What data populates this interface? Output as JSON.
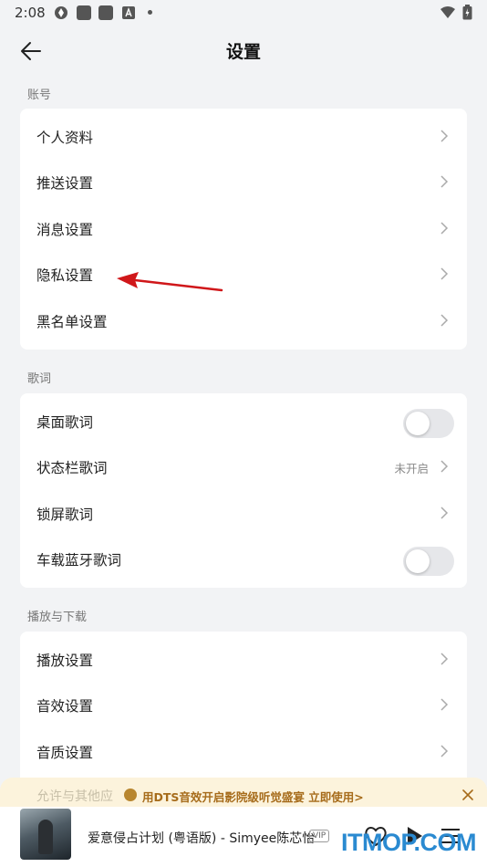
{
  "status_bar": {
    "time": "2:08"
  },
  "header": {
    "title": "设置"
  },
  "sections": [
    {
      "label": "账号",
      "items": [
        {
          "label": "个人资料"
        },
        {
          "label": "推送设置"
        },
        {
          "label": "消息设置"
        },
        {
          "label": "隐私设置"
        },
        {
          "label": "黑名单设置"
        }
      ]
    },
    {
      "label": "歌词",
      "items": [
        {
          "label": "桌面歌词",
          "toggle": false
        },
        {
          "label": "状态栏歌词",
          "value": "未开启"
        },
        {
          "label": "锁屏歌词"
        },
        {
          "label": "车载蓝牙歌词",
          "toggle": false
        }
      ]
    },
    {
      "label": "播放与下载",
      "items": [
        {
          "label": "播放设置"
        },
        {
          "label": "音效设置"
        },
        {
          "label": "音质设置"
        },
        {
          "label": "允许与其他应"
        }
      ]
    }
  ],
  "promo": {
    "text": "用DTS音效开启影院级听觉盛宴 立即使用>"
  },
  "player": {
    "song": "爱意侵占计划 (粤语版) - Simyee陈芯怡",
    "badge": "VIP"
  },
  "watermark": "ITMOP.COM",
  "colors": {
    "accent": "#2a8ad1",
    "annotation_arrow": "#d0171a",
    "promo_text": "#a66b1a",
    "background": "#f2f3f5"
  }
}
